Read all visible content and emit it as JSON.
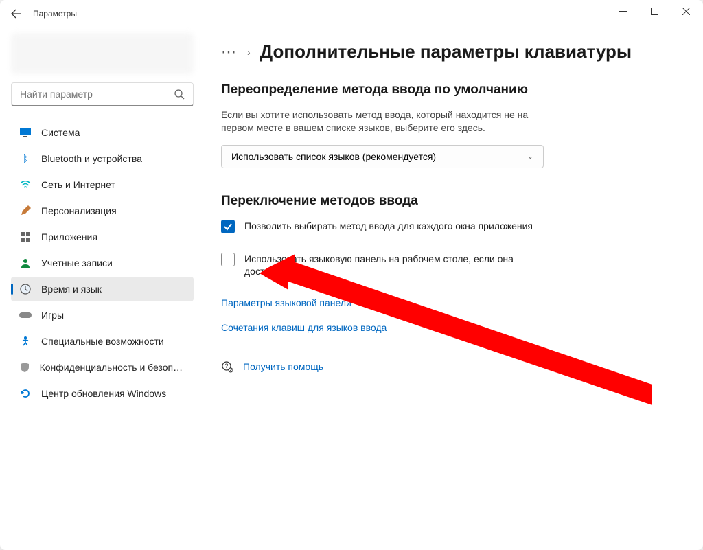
{
  "window": {
    "title": "Параметры"
  },
  "search": {
    "placeholder": "Найти параметр"
  },
  "sidebar": {
    "items": [
      {
        "label": "Система",
        "icon": "system",
        "color": "#0078d4"
      },
      {
        "label": "Bluetooth и устройства",
        "icon": "bluetooth",
        "color": "#0078d4"
      },
      {
        "label": "Сеть и Интернет",
        "icon": "network",
        "color": "#00b7c3"
      },
      {
        "label": "Персонализация",
        "icon": "personalization",
        "color": "#6b4226"
      },
      {
        "label": "Приложения",
        "icon": "apps",
        "color": "#555"
      },
      {
        "label": "Учетные записи",
        "icon": "accounts",
        "color": "#10893e"
      },
      {
        "label": "Время и язык",
        "icon": "timelang",
        "color": "#555",
        "active": true
      },
      {
        "label": "Игры",
        "icon": "gaming",
        "color": "#555"
      },
      {
        "label": "Специальные возможности",
        "icon": "accessibility",
        "color": "#0078d4"
      },
      {
        "label": "Конфиденциальность и безопасность",
        "icon": "privacy",
        "color": "#888"
      },
      {
        "label": "Центр обновления Windows",
        "icon": "update",
        "color": "#0078d4"
      }
    ]
  },
  "breadcrumb": {
    "title": "Дополнительные параметры клавиатуры"
  },
  "section1": {
    "title": "Переопределение метода ввода по умолчанию",
    "desc": "Если вы хотите использовать метод ввода, который находится не на первом месте в вашем списке языков, выберите его здесь.",
    "dropdown_value": "Использовать список языков (рекомендуется)"
  },
  "section2": {
    "title": "Переключение методов ввода",
    "check1_label": "Позволить выбирать метод ввода для каждого окна приложения",
    "check1_checked": true,
    "check2_label": "Использовать языковую панель на рабочем столе, если она доступна",
    "check2_checked": false,
    "link1": "Параметры языковой панели",
    "link2": "Сочетания клавиш для языков ввода"
  },
  "help": {
    "label": "Получить помощь"
  }
}
